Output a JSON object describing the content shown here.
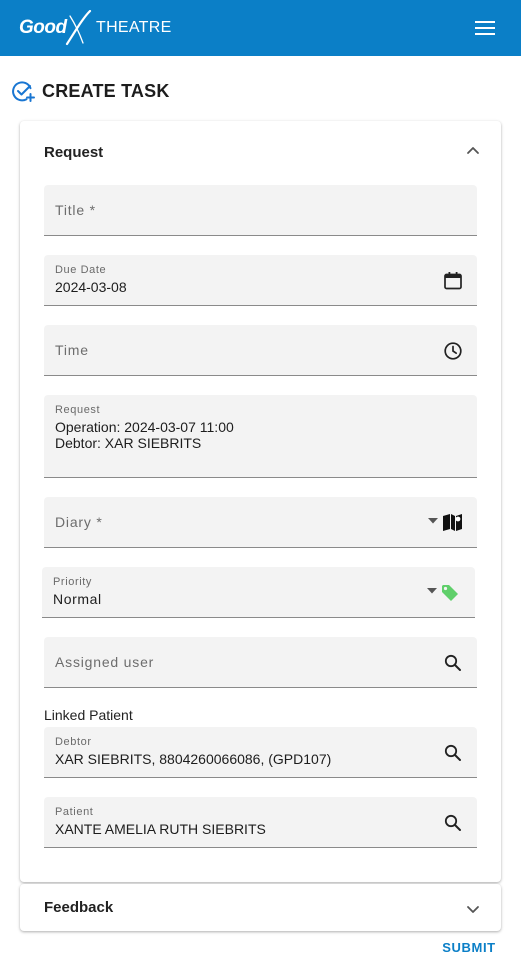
{
  "app": {
    "brand_word": "Good",
    "brand_product": "THEATRE",
    "menu_icon": "hamburger-menu-icon",
    "brand_color": "#0b7fc7"
  },
  "page": {
    "title": "CREATE TASK",
    "icon": "circle-check-plus-icon"
  },
  "request_section": {
    "title": "Request",
    "expanded": true,
    "fields": {
      "title": {
        "label": "Title *",
        "value": ""
      },
      "due_date": {
        "label": "Due Date",
        "value": "2024-03-08",
        "icon": "calendar-icon"
      },
      "time": {
        "label": "Time",
        "value": "",
        "icon": "clock-icon"
      },
      "request": {
        "label": "Request",
        "line1": "Operation: 2024-03-07 11:00",
        "line2": "Debtor: XAR SIEBRITS"
      },
      "diary": {
        "label": "Diary *",
        "value": "",
        "icon": "book-map-icon"
      },
      "priority": {
        "label": "Priority",
        "value": "Normal",
        "icon": "tag-icon",
        "icon_color": "#5fcf6a"
      },
      "assigned_user": {
        "label": "Assigned user",
        "value": "",
        "icon": "search-icon"
      }
    },
    "linked_patient": {
      "label": "Linked Patient",
      "debtor": {
        "label": "Debtor",
        "value": "XAR SIEBRITS, 8804260066086, (GPD107)",
        "icon": "search-icon"
      },
      "patient": {
        "label": "Patient",
        "value": "XANTE AMELIA RUTH SIEBRITS",
        "icon": "search-icon"
      }
    }
  },
  "feedback_section": {
    "title": "Feedback",
    "expanded": false
  },
  "actions": {
    "submit_label": "SUBMIT"
  }
}
